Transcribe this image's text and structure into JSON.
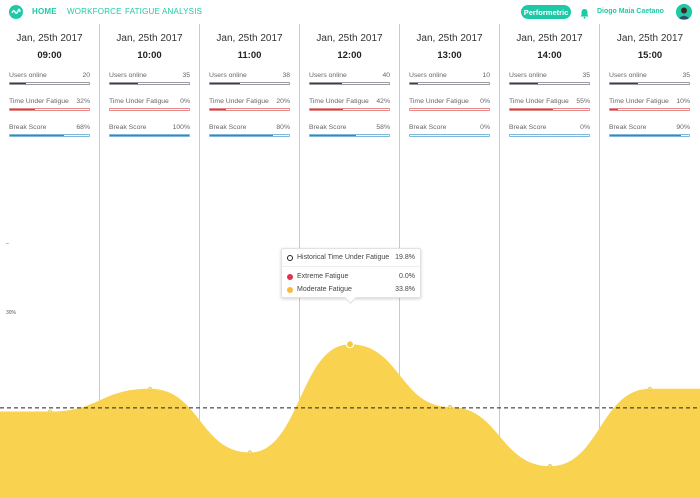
{
  "nav": {
    "home": "HOME",
    "workforce": "WORKFORCE",
    "fatigue_analysis": "FATIGUE ANALYSIS",
    "accent": "#1fc9a7"
  },
  "header": {
    "brand": "Performetric",
    "user_name": "Diogo Maia Caetano",
    "bell_icon": "bell-icon",
    "logo_icon": "wave-logo-icon"
  },
  "columns": [
    {
      "date": "Jan, 25th 2017",
      "time": "09:00",
      "users_label": "Users online",
      "users": "20",
      "users_frac": 0.2,
      "fatigue_label": "Time Under Fatigue",
      "fatigue": "32%",
      "fatigue_frac": 0.32,
      "break_label": "Break Score",
      "break": "68%",
      "break_frac": 0.68
    },
    {
      "date": "Jan, 25th 2017",
      "time": "10:00",
      "users_label": "Users online",
      "users": "35",
      "users_frac": 0.35,
      "fatigue_label": "Time Under Fatigue",
      "fatigue": "0%",
      "fatigue_frac": 0.0,
      "break_label": "Break Score",
      "break": "100%",
      "break_frac": 1.0
    },
    {
      "date": "Jan, 25th 2017",
      "time": "11:00",
      "users_label": "Users online",
      "users": "38",
      "users_frac": 0.38,
      "fatigue_label": "Time Under Fatigue",
      "fatigue": "20%",
      "fatigue_frac": 0.2,
      "break_label": "Break Score",
      "break": "80%",
      "break_frac": 0.8
    },
    {
      "date": "Jan, 25th 2017",
      "time": "12:00",
      "users_label": "Users online",
      "users": "40",
      "users_frac": 0.4,
      "fatigue_label": "Time Under Fatigue",
      "fatigue": "42%",
      "fatigue_frac": 0.42,
      "break_label": "Break Score",
      "break": "58%",
      "break_frac": 0.58
    },
    {
      "date": "Jan, 25th 2017",
      "time": "13:00",
      "users_label": "Users online",
      "users": "10",
      "users_frac": 0.1,
      "fatigue_label": "Time Under Fatigue",
      "fatigue": "0%",
      "fatigue_frac": 0.0,
      "break_label": "Break Score",
      "break": "0%",
      "break_frac": 0.0
    },
    {
      "date": "Jan, 25th 2017",
      "time": "14:00",
      "users_label": "Users online",
      "users": "35",
      "users_frac": 0.35,
      "fatigue_label": "Time Under Fatigue",
      "fatigue": "55%",
      "fatigue_frac": 0.55,
      "break_label": "Break Score",
      "break": "0%",
      "break_frac": 0.0
    },
    {
      "date": "Jan, 25th 2017",
      "time": "15:00",
      "users_label": "Users online",
      "users": "35",
      "users_frac": 0.35,
      "fatigue_label": "Time Under Fatigue",
      "fatigue": "10%",
      "fatigue_frac": 0.1,
      "break_label": "Break Score",
      "break": "90%",
      "break_frac": 0.9
    }
  ],
  "chart_data": {
    "type": "area",
    "x": [
      "09:00",
      "10:00",
      "11:00",
      "12:00",
      "13:00",
      "14:00",
      "15:00"
    ],
    "series": [
      {
        "name": "Moderate Fatigue",
        "values": [
          19,
          24,
          10,
          33.8,
          20,
          7,
          24
        ],
        "color": "#f9d350"
      }
    ],
    "reference_line": {
      "value": 19.8,
      "style": "dashed"
    },
    "ylim": [
      0,
      60
    ],
    "axis_tick_label": "30%",
    "colors": {
      "extreme": "#e0334d",
      "moderate": "#f9d350",
      "historical": "#222222"
    }
  },
  "tooltip": {
    "historical_label": "Historical Time Under Fatigue",
    "historical_value": "19.8%",
    "extreme_label": "Extreme Fatigue",
    "extreme_value": "0.0%",
    "moderate_label": "Moderate Fatigue",
    "moderate_value": "33.8%"
  }
}
